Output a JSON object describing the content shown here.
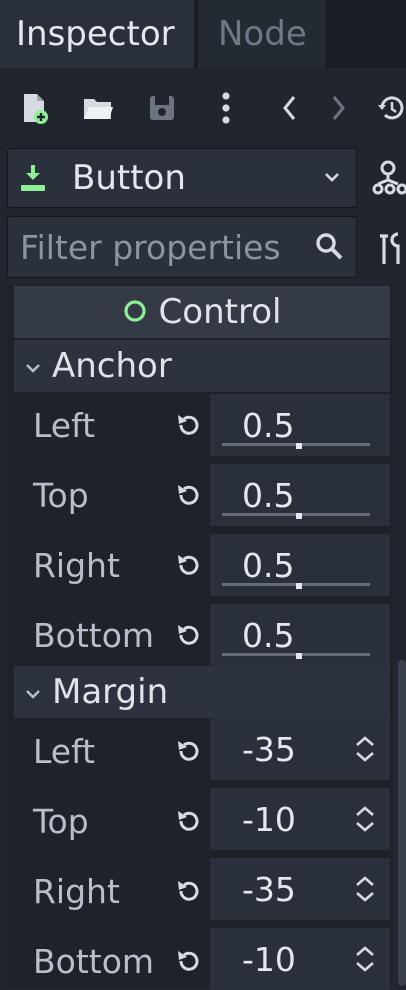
{
  "tabs": [
    {
      "label": "Inspector",
      "active": true
    },
    {
      "label": "Node",
      "active": false
    }
  ],
  "toolbar": {
    "icons": [
      "new-resource-icon",
      "open-folder-icon",
      "save-icon",
      "kebab-menu-icon",
      "history-back-icon",
      "history-forward-icon",
      "history-icon"
    ]
  },
  "node_selector": {
    "label": "Button",
    "icon": "button-node-icon"
  },
  "filter": {
    "placeholder": "Filter properties"
  },
  "section": {
    "title": "Control"
  },
  "groups": {
    "anchor": {
      "title": "Anchor",
      "rows": [
        {
          "label": "Left",
          "value": "0.5",
          "fill": 0.5
        },
        {
          "label": "Top",
          "value": "0.5",
          "fill": 0.5
        },
        {
          "label": "Right",
          "value": "0.5",
          "fill": 0.5
        },
        {
          "label": "Bottom",
          "value": "0.5",
          "fill": 0.5
        }
      ]
    },
    "margin": {
      "title": "Margin",
      "rows": [
        {
          "label": "Left",
          "value": "-35"
        },
        {
          "label": "Top",
          "value": "-10"
        },
        {
          "label": "Right",
          "value": "-35"
        },
        {
          "label": "Bottom",
          "value": "-10"
        }
      ]
    }
  },
  "colors": {
    "accent_green": "#8eef97",
    "background": "#21262e",
    "panel": "#1e232a"
  }
}
